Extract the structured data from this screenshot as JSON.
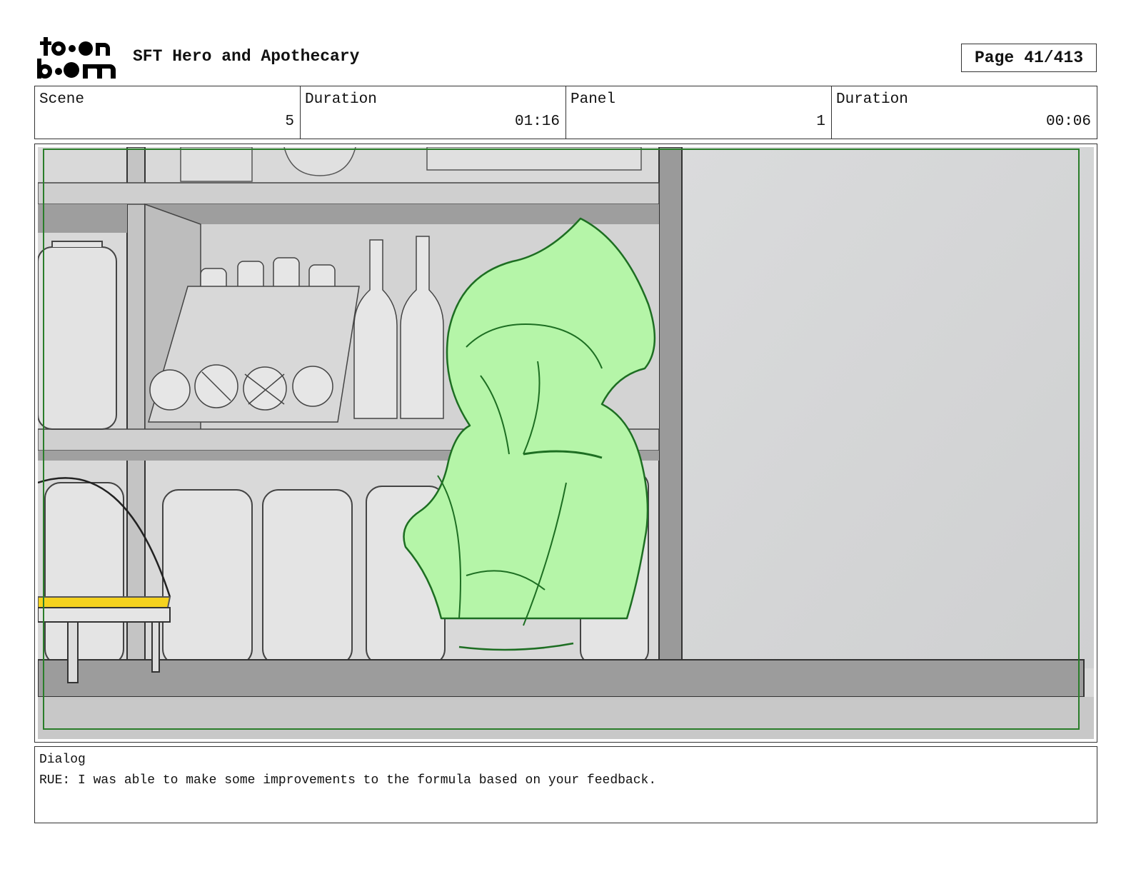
{
  "header": {
    "logo_text": "toon boom",
    "project_title": "SFT Hero and Apothecary",
    "page_label": "Page",
    "page_number": "41/413"
  },
  "info": {
    "scene_label": "Scene",
    "scene_value": "5",
    "scene_duration_label": "Duration",
    "scene_duration_value": "01:16",
    "panel_label": "Panel",
    "panel_value": "1",
    "panel_duration_label": "Duration",
    "panel_duration_value": "00:06"
  },
  "dialog": {
    "label": "Dialog",
    "text": "RUE: I was able to make some improvements to the formula based on your feedback."
  },
  "colors": {
    "character_fill": "#b5f5a8",
    "character_line": "#1d6e22",
    "safe_frame": "#2a7d2a",
    "basket_yellow": "#f5d21e",
    "wall": "#d6d7d8"
  }
}
